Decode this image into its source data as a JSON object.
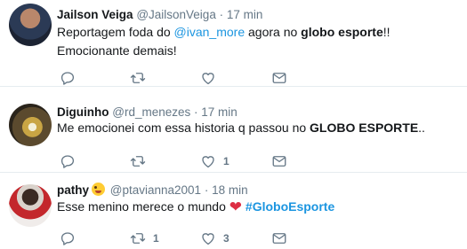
{
  "tweets": [
    {
      "name": "Jailson Veiga",
      "handle": "@JailsonVeiga",
      "dot": "·",
      "time": "17 min",
      "text": {
        "t1": "Reportagem foda do ",
        "mention": "@ivan_more",
        "t2": " agora no ",
        "strong": "globo esporte",
        "t3": "!! Emocionante demais!"
      },
      "retweets": "",
      "likes": ""
    },
    {
      "name": "Diguinho",
      "handle": "@rd_menezes",
      "dot": "·",
      "time": "17 min",
      "text": {
        "t1": "Me emocionei com essa historia q passou no ",
        "strong": "GLOBO ESPORTE",
        "t2": ".."
      },
      "retweets": "",
      "likes": "1"
    },
    {
      "name": "pathy",
      "handle": "@ptavianna2001",
      "dot": "·",
      "time": "18 min",
      "text": {
        "t1": "Esse menino merece o mundo ",
        "heart": "❤",
        "hashtag": "#GloboEsporte"
      },
      "retweets": "1",
      "likes": "3"
    }
  ],
  "icons": [
    "reply-icon",
    "retweet-icon",
    "like-icon",
    "direct-message-icon"
  ],
  "colors": {
    "link": "#1b95e0",
    "muted": "#657786",
    "divider": "#e6ecf0",
    "heart": "#dd2e44"
  }
}
